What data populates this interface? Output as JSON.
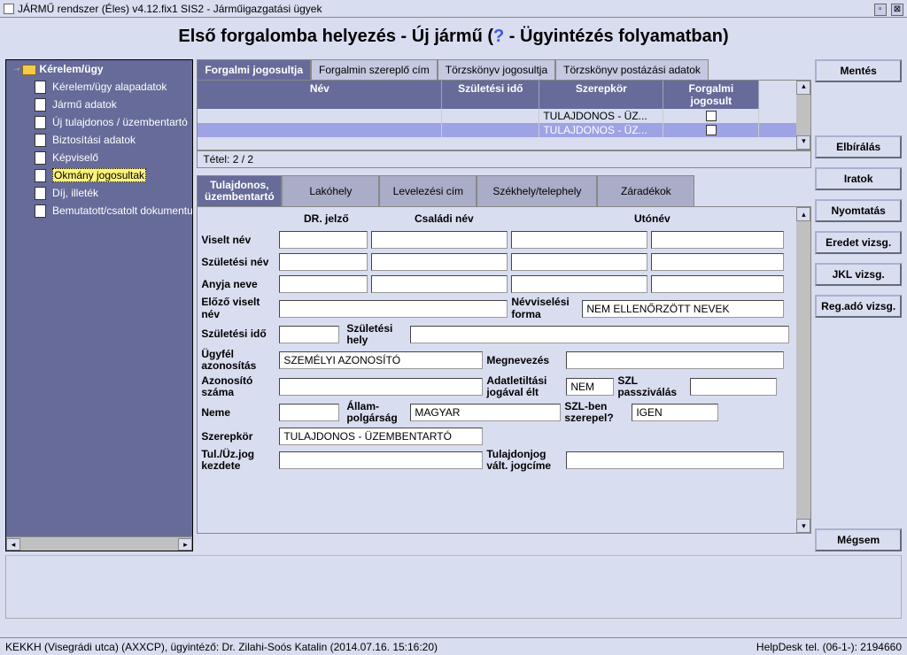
{
  "window_title": "JÁRMŰ rendszer (Éles) v4.12.fix1 SIS2 - Járműigazgatási ügyek",
  "header": {
    "before": "Első forgalomba helyezés - Új jármű (",
    "q": "?",
    "after": " - Ügyintézés folyamatban)"
  },
  "tree": {
    "root": "Kérelem/ügy",
    "items": [
      "Kérelem/ügy alapadatok",
      "Jármű adatok",
      "Új tulajdonos / üzembentartó",
      "Biztosítási adatok",
      "Képviselő",
      "Okmány jogosultak",
      "Díj, illeték",
      "Bemutatott/csatolt dokumentu"
    ],
    "selectedIndex": 5
  },
  "tabs1": [
    "Forgalmi jogosultja",
    "Forgalmin szereplő cím",
    "Törzskönyv jogosultja",
    "Törzskönyv postázási adatok"
  ],
  "grid": {
    "headers": [
      "Név",
      "Születési idő",
      "Szerepkör",
      "Forgalmi jogosult"
    ],
    "rows": [
      {
        "nev": "",
        "szul": "",
        "role": "TULAJDONOS - ÜZ...",
        "jog": false,
        "sel": false
      },
      {
        "nev": "",
        "szul": "",
        "role": "TULAJDONOS - ÜZ...",
        "jog": true,
        "sel": true
      }
    ],
    "footer": "Tétel: 2 / 2"
  },
  "tabs2": [
    "Tulajdonos,\nüzembentartó",
    "Lakóhely",
    "Levelezési cím",
    "Székhely/telephely",
    "Záradékok"
  ],
  "form": {
    "colhead": {
      "dr": "DR. jelző",
      "csaladi": "Családi név",
      "uto": "Utónév"
    },
    "labels": {
      "viselt": "Viselt név",
      "szulnev": "Születési név",
      "anyja": "Anyja neve",
      "elozo": "Előző viselt név",
      "nevvis": "Névviselési forma",
      "nevvis_val": "NEM ELLENŐRZÖTT NEVEK",
      "szulido": "Születési idő",
      "szulhely": "Születési hely",
      "ugyfel": "Ügyfél azonosítás",
      "ugyfel_val": "SZEMÉLYI AZONOSÍTÓ",
      "megnev": "Megnevezés",
      "azon": "Azonosító száma",
      "adat": "Adatletiltási jogával élt",
      "adat_val": "NEM",
      "szlpass": "SZL passziválás",
      "neme": "Neme",
      "allam": "Állam-polgárság",
      "allam_val": "MAGYAR",
      "szlben": "SZL-ben szerepel?",
      "szlben_val": "IGEN",
      "szerep": "Szerepkör",
      "szerep_val": "TULAJDONOS - ÜZEMBENTARTÓ",
      "tuljog": "Tul./Üz.jog kezdete",
      "tulcim": "Tulajdonjog vált. jogcíme"
    }
  },
  "buttons": {
    "mentes": "Mentés",
    "elbiralas": "Elbírálás",
    "iratok": "Iratok",
    "nyomtatas": "Nyomtatás",
    "eredet": "Eredet vizsg.",
    "jkl": "JKL vizsg.",
    "regado": "Reg.adó vizsg.",
    "megsem": "Mégsem"
  },
  "status": {
    "left": "KEKKH (Visegrádi utca) (AXXCP), ügyintéző: Dr. Zilahi-Soós Katalin (2014.07.16. 15:16:20)",
    "right": "HelpDesk tel. (06-1-): 2194660"
  }
}
